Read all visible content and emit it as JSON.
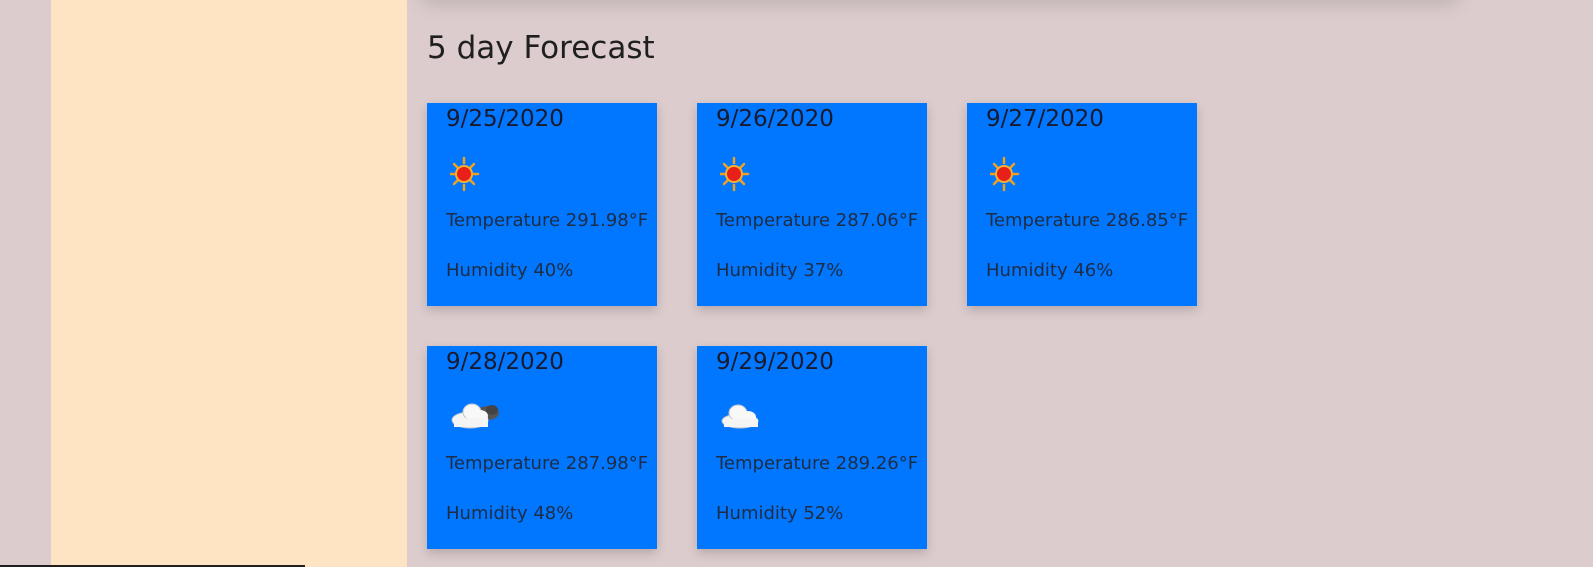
{
  "forecast": {
    "title": "5 day Forecast",
    "days": [
      {
        "date": "9/25/2020",
        "icon": "sun-icon",
        "temperature": "Temperature 291.98°F",
        "humidity": "Humidity 40%"
      },
      {
        "date": "9/26/2020",
        "icon": "sun-icon",
        "temperature": "Temperature 287.06°F",
        "humidity": "Humidity 37%"
      },
      {
        "date": "9/27/2020",
        "icon": "sun-icon",
        "temperature": "Temperature 286.85°F",
        "humidity": "Humidity 46%"
      },
      {
        "date": "9/28/2020",
        "icon": "cloud-icon",
        "temperature": "Temperature 287.98°F",
        "humidity": "Humidity 48%"
      },
      {
        "date": "9/29/2020",
        "icon": "cloud-icon",
        "temperature": "Temperature 289.26°F",
        "humidity": "Humidity 52%"
      }
    ]
  },
  "colors": {
    "page_background": "#dcccce",
    "sidebar_background": "#ffe4c4",
    "card_background": "#0176ff"
  }
}
